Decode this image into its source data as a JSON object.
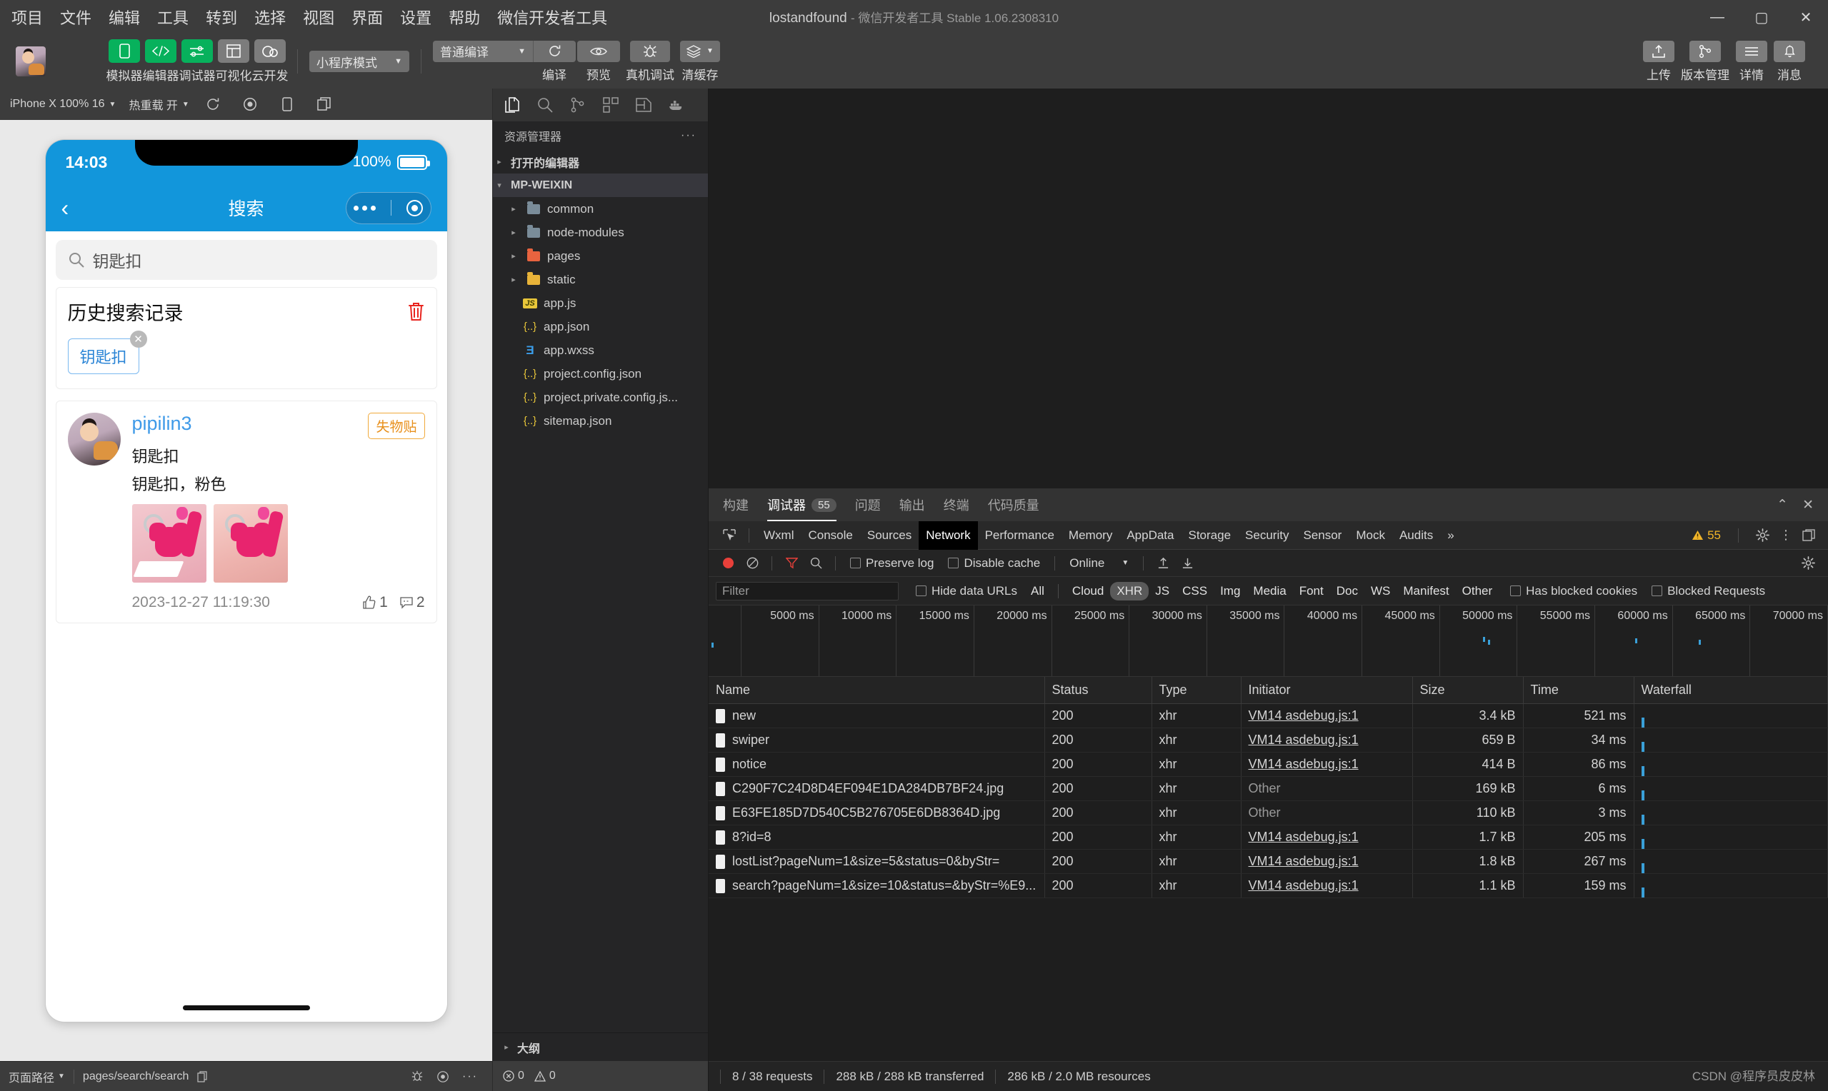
{
  "window": {
    "title": "lostandfound",
    "subtitle": "- 微信开发者工具 Stable 1.06.2308310",
    "minimize": "—",
    "maximize": "▢",
    "close": "✕"
  },
  "menubar": [
    "项目",
    "文件",
    "编辑",
    "工具",
    "转到",
    "选择",
    "视图",
    "界面",
    "设置",
    "帮助",
    "微信开发者工具"
  ],
  "toolbar": {
    "modes": [
      {
        "label": "模拟器",
        "icon": "phone-icon",
        "color": "green"
      },
      {
        "label": "编辑器",
        "icon": "code-icon",
        "color": "green"
      },
      {
        "label": "调试器",
        "icon": "sliders-icon",
        "color": "green"
      },
      {
        "label": "可视化",
        "icon": "layout-icon",
        "color": "grey"
      },
      {
        "label": "云开发",
        "icon": "cloud-icon",
        "color": "grey"
      }
    ],
    "mode_select": "小程序模式",
    "compile_select": "普通编译",
    "actions": [
      {
        "label": "编译",
        "icon": "refresh-icon"
      },
      {
        "label": "预览",
        "icon": "eye-icon"
      },
      {
        "label": "真机调试",
        "icon": "bug-icon"
      },
      {
        "label": "清缓存",
        "icon": "layers-icon"
      }
    ],
    "right": [
      {
        "label": "上传",
        "icon": "upload-icon"
      },
      {
        "label": "版本管理",
        "icon": "branch-icon"
      },
      {
        "label": "详情",
        "icon": "menu-icon"
      },
      {
        "label": "消息",
        "icon": "bell-icon"
      }
    ]
  },
  "simulator": {
    "device": "iPhone X 100% 16",
    "hot_reload": "热重载 开",
    "icons": [
      "rotate-icon",
      "record-icon",
      "device-icon",
      "copy-icon"
    ],
    "phone": {
      "status_time": "14:03",
      "battery_percent": "100%",
      "nav_title": "搜索",
      "search_value": "钥匙扣",
      "history_title": "历史搜索记录",
      "history_tags": [
        "钥匙扣"
      ],
      "post": {
        "username": "pipilin3",
        "badge": "失物贴",
        "title": "钥匙扣",
        "desc": "钥匙扣，粉色",
        "date": "2023-12-27 11:19:30",
        "likes": "1",
        "comments": "2"
      }
    },
    "footer": {
      "path_label": "页面路径",
      "path_value": "pages/search/search"
    }
  },
  "explorer": {
    "action_icons": [
      "files-icon",
      "search-icon",
      "source-control-icon",
      "extensions-icon",
      "remote-icon",
      "docker-icon"
    ],
    "header": "资源管理器",
    "more": "···",
    "tree": [
      {
        "label": "打开的编辑器",
        "depth": 0,
        "arrow": "▸",
        "kind": "section",
        "selected": false
      },
      {
        "label": "MP-WEIXIN",
        "depth": 0,
        "arrow": "▾",
        "kind": "section",
        "selected": true
      },
      {
        "label": "common",
        "depth": 1,
        "arrow": "▸",
        "kind": "folder",
        "selected": false
      },
      {
        "label": "node-modules",
        "depth": 1,
        "arrow": "▸",
        "kind": "folder",
        "selected": false
      },
      {
        "label": "pages",
        "depth": 1,
        "arrow": "▸",
        "kind": "folder-red",
        "selected": false
      },
      {
        "label": "static",
        "depth": 1,
        "arrow": "▸",
        "kind": "folder-yellow",
        "selected": false
      },
      {
        "label": "app.js",
        "depth": 2,
        "arrow": "",
        "kind": "js",
        "selected": false
      },
      {
        "label": "app.json",
        "depth": 2,
        "arrow": "",
        "kind": "json",
        "selected": false
      },
      {
        "label": "app.wxss",
        "depth": 2,
        "arrow": "",
        "kind": "wxss",
        "selected": false
      },
      {
        "label": "project.config.json",
        "depth": 2,
        "arrow": "",
        "kind": "json",
        "selected": false
      },
      {
        "label": "project.private.config.js...",
        "depth": 2,
        "arrow": "",
        "kind": "json",
        "selected": false
      },
      {
        "label": "sitemap.json",
        "depth": 2,
        "arrow": "",
        "kind": "json",
        "selected": false
      }
    ],
    "outline": "大纲",
    "footer": {
      "errors": "0",
      "warnings": "0"
    }
  },
  "devtools": {
    "panel_tabs": [
      {
        "label": "构建",
        "active": false,
        "count": null
      },
      {
        "label": "调试器",
        "active": true,
        "count": "55"
      },
      {
        "label": "问题",
        "active": false,
        "count": null
      },
      {
        "label": "输出",
        "active": false,
        "count": null
      },
      {
        "label": "终端",
        "active": false,
        "count": null
      },
      {
        "label": "代码质量",
        "active": false,
        "count": null
      }
    ],
    "panel_collapse": "⌃",
    "panel_close": "✕",
    "tabs": [
      {
        "label": "Wxml",
        "active": false
      },
      {
        "label": "Console",
        "active": false
      },
      {
        "label": "Sources",
        "active": false
      },
      {
        "label": "Network",
        "active": true
      },
      {
        "label": "Performance",
        "active": false
      },
      {
        "label": "Memory",
        "active": false
      },
      {
        "label": "AppData",
        "active": false
      },
      {
        "label": "Storage",
        "active": false
      },
      {
        "label": "Security",
        "active": false
      },
      {
        "label": "Sensor",
        "active": false
      },
      {
        "label": "Mock",
        "active": false
      },
      {
        "label": "Audits",
        "active": false
      }
    ],
    "overflow": "»",
    "warning_count": "55",
    "controls": {
      "preserve_log": "Preserve log",
      "disable_cache": "Disable cache",
      "throttle": "Online"
    },
    "filter": {
      "placeholder": "Filter",
      "hide_data_urls": "Hide data URLs",
      "types": [
        "All",
        "Cloud",
        "XHR",
        "JS",
        "CSS",
        "Img",
        "Media",
        "Font",
        "Doc",
        "WS",
        "Manifest",
        "Other"
      ],
      "active_type": "XHR",
      "has_blocked_cookies": "Has blocked cookies",
      "blocked_requests": "Blocked Requests"
    },
    "timeline_ticks": [
      "5000 ms",
      "10000 ms",
      "15000 ms",
      "20000 ms",
      "25000 ms",
      "30000 ms",
      "35000 ms",
      "40000 ms",
      "45000 ms",
      "50000 ms",
      "55000 ms",
      "60000 ms",
      "65000 ms",
      "70000 ms"
    ],
    "columns": [
      "Name",
      "Status",
      "Type",
      "Initiator",
      "Size",
      "Time",
      "Waterfall"
    ],
    "rows": [
      {
        "name": "new",
        "status": "200",
        "type": "xhr",
        "initiator": "VM14 asdebug.js:1",
        "initiator_link": true,
        "size": "3.4 kB",
        "time": "521 ms",
        "wf": 2
      },
      {
        "name": "swiper",
        "status": "200",
        "type": "xhr",
        "initiator": "VM14 asdebug.js:1",
        "initiator_link": true,
        "size": "659 B",
        "time": "34 ms",
        "wf": 2
      },
      {
        "name": "notice",
        "status": "200",
        "type": "xhr",
        "initiator": "VM14 asdebug.js:1",
        "initiator_link": true,
        "size": "414 B",
        "time": "86 ms",
        "wf": 2
      },
      {
        "name": "C290F7C24D8D4EF094E1DA284DB7BF24.jpg",
        "status": "200",
        "type": "xhr",
        "initiator": "Other",
        "initiator_link": false,
        "size": "169 kB",
        "time": "6 ms",
        "wf": 3
      },
      {
        "name": "E63FE185D7D540C5B276705E6DB8364D.jpg",
        "status": "200",
        "type": "xhr",
        "initiator": "Other",
        "initiator_link": false,
        "size": "110 kB",
        "time": "3 ms",
        "wf": 3
      },
      {
        "name": "8?id=8",
        "status": "200",
        "type": "xhr",
        "initiator": "VM14 asdebug.js:1",
        "initiator_link": true,
        "size": "1.7 kB",
        "time": "205 ms",
        "wf": 48
      },
      {
        "name": "lostList?pageNum=1&size=5&status=0&byStr=",
        "status": "200",
        "type": "xhr",
        "initiator": "VM14 asdebug.js:1",
        "initiator_link": true,
        "size": "1.8 kB",
        "time": "267 ms",
        "wf": 2
      },
      {
        "name": "search?pageNum=1&size=10&status=&byStr=%E9...",
        "status": "200",
        "type": "xhr",
        "initiator": "VM14 asdebug.js:1",
        "initiator_link": true,
        "size": "1.1 kB",
        "time": "159 ms",
        "wf": 98
      }
    ],
    "status": [
      "8 / 38 requests",
      "288 kB / 288 kB transferred",
      "286 kB / 2.0 MB resources"
    ]
  },
  "watermark": "CSDN @程序员皮皮林"
}
